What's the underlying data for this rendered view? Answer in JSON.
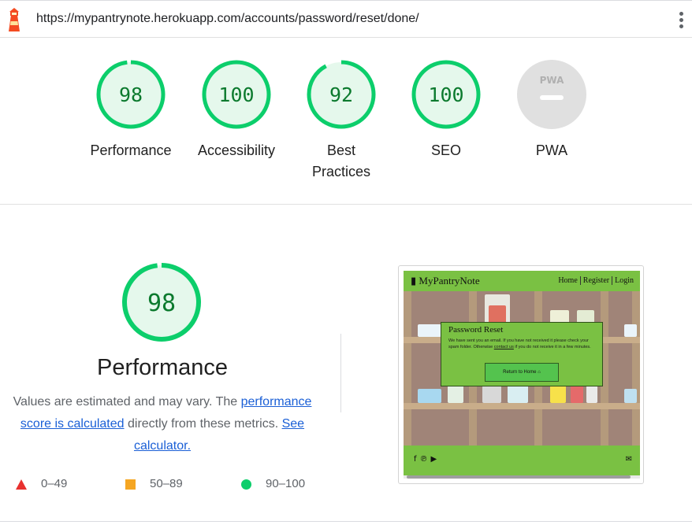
{
  "url_bar": {
    "url": "https://mypantrynote.herokuapp.com/accounts/password/reset/done/"
  },
  "categories": [
    {
      "label": "Performance",
      "score": "98",
      "score_fraction": 0.98
    },
    {
      "label": "Accessibility",
      "score": "100",
      "score_fraction": 1.0
    },
    {
      "label": "Best Practices",
      "score": "92",
      "score_fraction": 0.92
    },
    {
      "label": "SEO",
      "score": "100",
      "score_fraction": 1.0
    },
    {
      "label": "PWA",
      "score": "",
      "badge": "PWA"
    }
  ],
  "performance": {
    "score": "98",
    "score_fraction": 0.98,
    "title": "Performance",
    "desc_prefix": "Values are estimated and may vary. The ",
    "desc_link1": "performance score is calculated",
    "desc_mid": " directly from these metrics. ",
    "desc_link2": "See calculator."
  },
  "legend": [
    {
      "range": "0–49",
      "color": "#e8312f",
      "shape": "triangle"
    },
    {
      "range": "50–89",
      "color": "#f5a623",
      "shape": "square"
    },
    {
      "range": "90–100",
      "color": "#0cce6b",
      "shape": "circle"
    }
  ],
  "screenshot": {
    "brand": "MyPantryNote",
    "nav": [
      "Home",
      "Register",
      "Login"
    ],
    "modal_title": "Password Reset",
    "modal_text_a": "We have sent you an email. If you have not received it please check your spam folder. Otherwise ",
    "modal_link": "contact us",
    "modal_text_b": " if you do not receive it in a few minutes.",
    "modal_button": "Return to Home",
    "home_icon": "home-icon",
    "social_icons": [
      "facebook-icon",
      "pinterest-icon",
      "youtube-icon"
    ],
    "mail_icon": "envelope-icon"
  },
  "colors": {
    "pass_green": "#0cce6b",
    "score_text": "#0c7a2e",
    "gauge_fill": "#e5f8ec",
    "site_green": "#7ac143"
  }
}
